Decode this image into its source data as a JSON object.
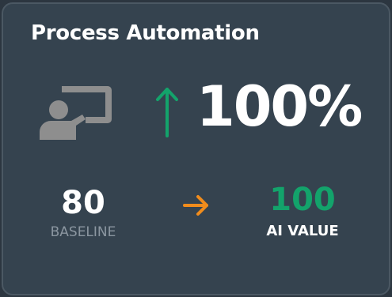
{
  "card": {
    "title": "Process Automation",
    "change_percent": "100%",
    "trend_icon": "arrow-up-icon",
    "presenter_icon": "presenter-board-icon",
    "baseline": {
      "value": "80",
      "label": "BASELINE"
    },
    "transition_icon": "arrow-right-icon",
    "ai": {
      "value": "100",
      "label": "AI VALUE"
    }
  },
  "colors": {
    "background": "#2c3640",
    "card": "#35434f",
    "up_arrow": "#13a36b",
    "ai_value": "#13a36b",
    "right_arrow": "#f08c1c",
    "muted_text": "#8b96a0",
    "icon_gray": "#8e8e8e"
  }
}
